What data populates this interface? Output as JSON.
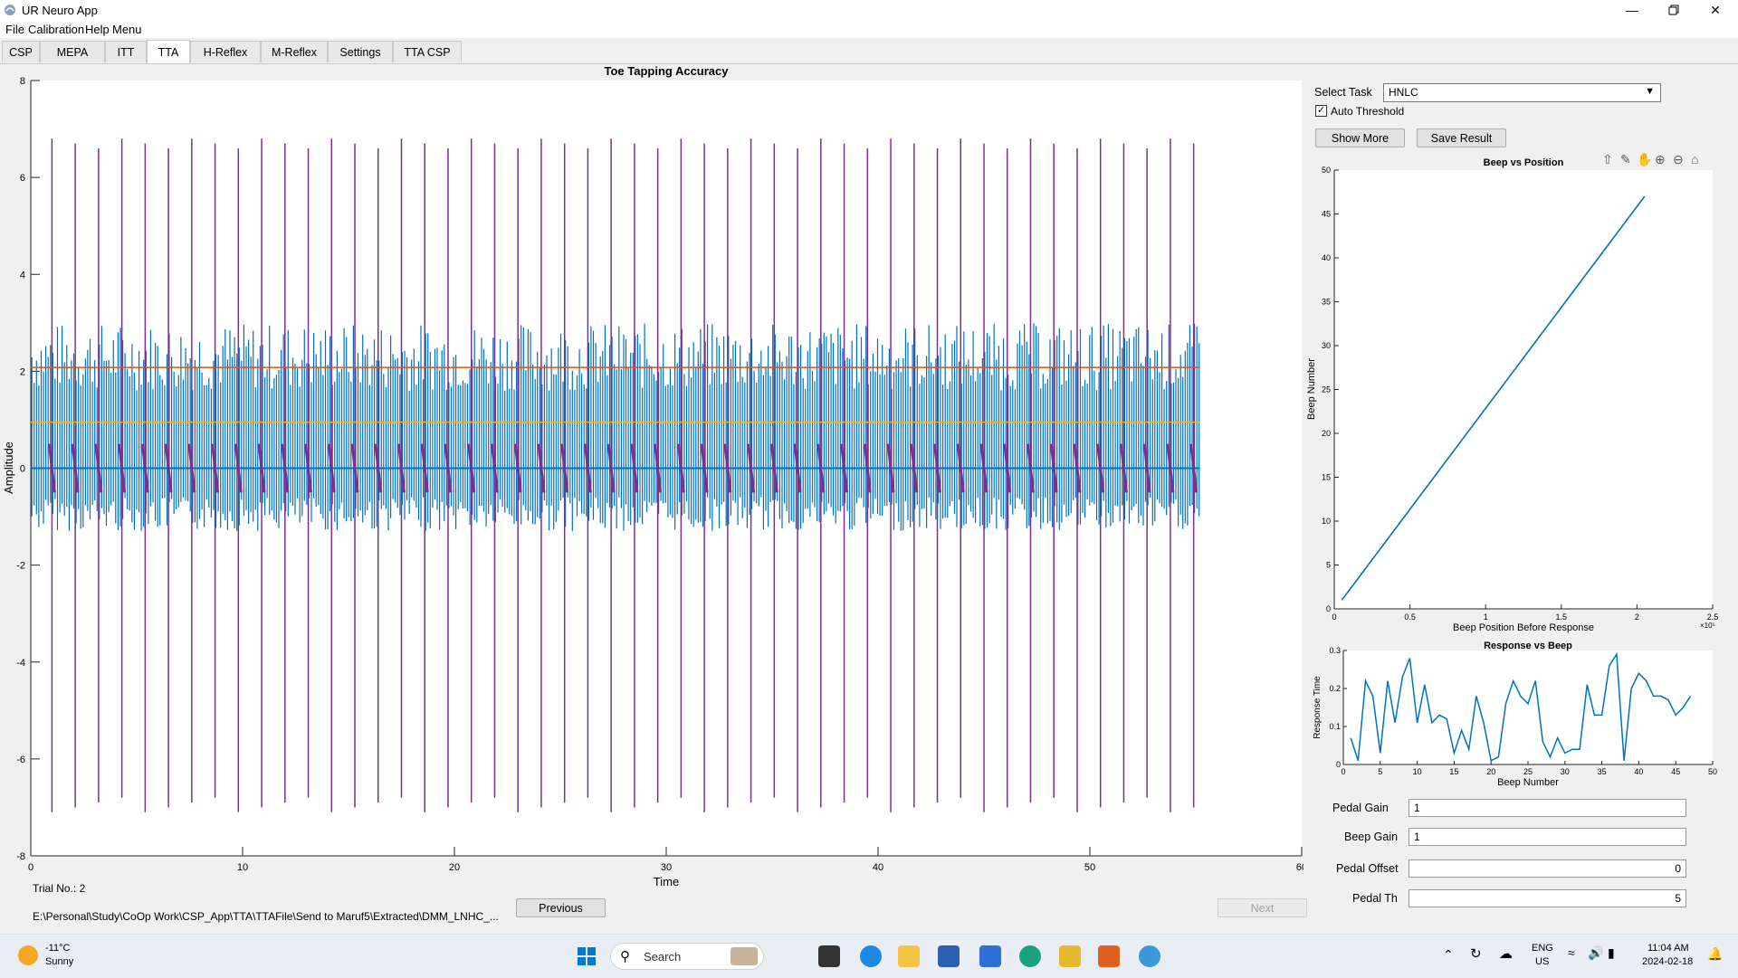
{
  "window": {
    "title": "UR Neuro App",
    "minimize_icon": "minimize-icon",
    "maximize_icon": "restore-icon",
    "close_icon": "close-icon"
  },
  "menu": [
    "File",
    "Calibration",
    "Help",
    "Menu"
  ],
  "tabs": [
    {
      "label": "CSP"
    },
    {
      "label": "MEPA"
    },
    {
      "label": "ITT"
    },
    {
      "label": "TTA",
      "active": true
    },
    {
      "label": "H-Reflex"
    },
    {
      "label": "M-Reflex"
    },
    {
      "label": "Settings"
    },
    {
      "label": "TTA CSP"
    }
  ],
  "main_plot": {
    "title": "Toe Tapping Accuracy",
    "xlabel": "Time",
    "ylabel": "Amplitude",
    "xticks": [
      "0",
      "10",
      "20",
      "30",
      "40",
      "50",
      "60"
    ],
    "yticks": [
      "8",
      "6",
      "4",
      "2",
      "0",
      "-2",
      "-4",
      "-6",
      "-8"
    ],
    "trial_label": "Trial No.: 2",
    "file_path": "E:\\Personal\\Study\\CoOp Work\\CSP_App\\TTA\\TTAFile\\Send to Maruf5\\Extracted\\DMM_LNHC_..."
  },
  "nav": {
    "previous": "Previous",
    "next": "Next"
  },
  "controls": {
    "select_task_label": "Select Task",
    "select_task_value": "HNLC",
    "auto_threshold_label": "Auto Threshold",
    "auto_threshold_checked": true,
    "show_more": "Show More",
    "save_result": "Save Result"
  },
  "toolbar_icons": [
    "export-icon",
    "brush-icon",
    "pan-icon",
    "zoom-in-icon",
    "zoom-out-icon",
    "home-icon"
  ],
  "settings": {
    "pedal_gain_label": "Pedal Gain",
    "pedal_gain": "1",
    "beep_gain_label": "Beep Gain",
    "beep_gain": "1",
    "pedal_offset_label": "Pedal Offset",
    "pedal_offset": "0",
    "pedal_th_label": "Pedal Th",
    "pedal_th": "5"
  },
  "chart_data": [
    {
      "type": "line",
      "title": "Toe Tapping Accuracy",
      "xlabel": "Time",
      "ylabel": "Amplitude",
      "xlim": [
        0,
        60
      ],
      "ylim": [
        -8,
        8
      ],
      "series": [
        {
          "name": "",
          "color": "#d95319",
          "x": [
            0,
            55.2
          ],
          "y": [
            2.08,
            2.08
          ]
        },
        {
          "name": "",
          "color": "#edb120",
          "x": [
            0,
            55.2
          ],
          "y": [
            0.95,
            0.95
          ]
        }
      ],
      "beep_spikes_x": [
        1.0,
        2.1,
        3.2,
        4.3,
        5.4,
        6.5,
        7.6,
        8.7,
        9.8,
        10.9,
        12.0,
        13.1,
        14.2,
        15.3,
        16.4,
        17.5,
        18.6,
        19.7,
        20.8,
        21.9,
        23.0,
        24.1,
        25.2,
        26.3,
        27.4,
        28.5,
        29.6,
        30.7,
        31.8,
        32.9,
        34.0,
        35.1,
        36.2,
        37.3,
        38.4,
        39.5,
        40.6,
        41.7,
        42.8,
        43.9,
        45.0,
        46.1,
        47.2,
        48.3,
        49.4,
        50.5,
        51.6,
        52.7,
        53.8,
        54.9
      ],
      "beep_spike_amplitude": [
        6.8,
        -7.1
      ],
      "pedal_signal_range": [
        -1.2,
        3.0
      ],
      "colors": {
        "pedal": "#0072bd",
        "beep": "#7e2f8e"
      }
    },
    {
      "type": "line",
      "title": "Beep vs Position",
      "xlabel": "Beep Position Before Response",
      "ylabel": "Beep Number",
      "x_exponent": "×10⁵",
      "xlim": [
        0,
        2.5
      ],
      "ylim": [
        0,
        50
      ],
      "xticks": [
        "0",
        "0.5",
        "1",
        "1.5",
        "2",
        "2.5"
      ],
      "yticks": [
        "0",
        "5",
        "10",
        "15",
        "20",
        "25",
        "30",
        "35",
        "40",
        "45",
        "50"
      ],
      "x": [
        0.05,
        2.05
      ],
      "y": [
        1,
        47
      ],
      "color": "#0072bd"
    },
    {
      "type": "line",
      "title": "Response vs Beep",
      "xlabel": "Beep Number",
      "ylabel": "Response Time",
      "xlim": [
        0,
        50
      ],
      "ylim": [
        0,
        0.3
      ],
      "xticks": [
        "0",
        "5",
        "10",
        "15",
        "20",
        "25",
        "30",
        "35",
        "40",
        "45",
        "50"
      ],
      "yticks": [
        "0",
        "0.1",
        "0.2",
        "0.3"
      ],
      "x": [
        1,
        2,
        3,
        4,
        5,
        6,
        7,
        8,
        9,
        10,
        11,
        12,
        13,
        14,
        15,
        16,
        17,
        18,
        19,
        20,
        21,
        22,
        23,
        24,
        25,
        26,
        27,
        28,
        29,
        30,
        31,
        32,
        33,
        34,
        35,
        36,
        37,
        38,
        39,
        40,
        41,
        42,
        43,
        44,
        45,
        46,
        47
      ],
      "y": [
        0.07,
        0.01,
        0.22,
        0.18,
        0.03,
        0.22,
        0.11,
        0.23,
        0.28,
        0.11,
        0.21,
        0.11,
        0.13,
        0.12,
        0.03,
        0.09,
        0.04,
        0.18,
        0.11,
        0.01,
        0.02,
        0.16,
        0.22,
        0.18,
        0.16,
        0.22,
        0.06,
        0.02,
        0.07,
        0.03,
        0.04,
        0.04,
        0.21,
        0.13,
        0.13,
        0.26,
        0.29,
        0.01,
        0.2,
        0.24,
        0.22,
        0.18,
        0.18,
        0.17,
        0.13,
        0.15,
        0.18
      ],
      "color": "#0072bd"
    }
  ],
  "taskbar": {
    "weather_temp": "-11°C",
    "weather_desc": "Sunny",
    "search_placeholder": "Search",
    "lang": "ENG",
    "region": "US",
    "time": "11:04 AM",
    "date": "2024-02-18"
  }
}
